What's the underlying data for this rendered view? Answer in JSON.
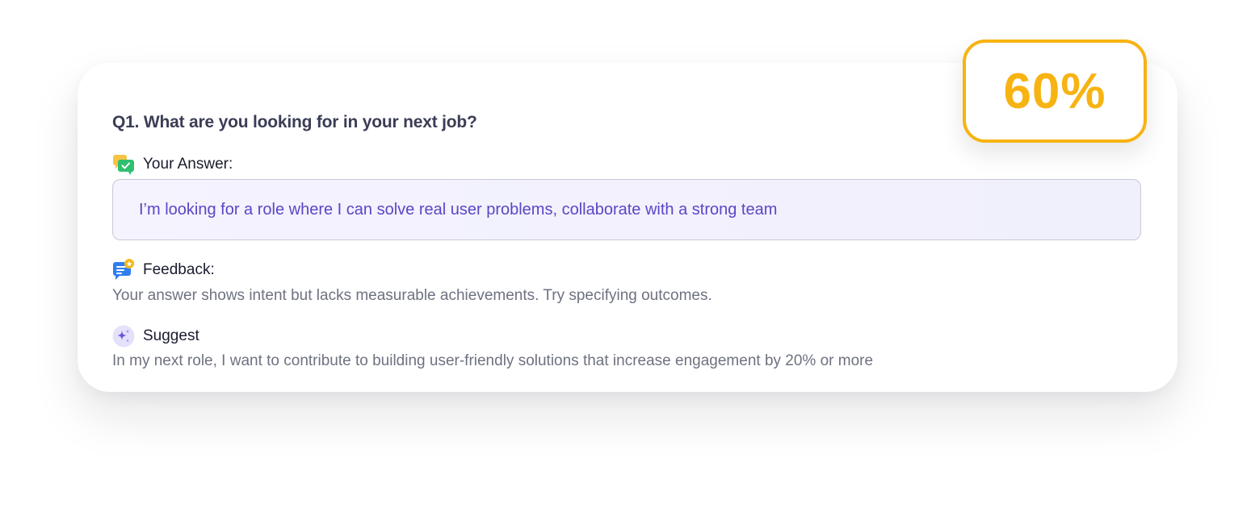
{
  "question": {
    "text": "Q1. What are you looking for in your next job?"
  },
  "answer": {
    "label": "Your Answer:",
    "icon": "chat-check-icon",
    "text": "I’m looking for a role where I can solve real user problems, collaborate with a strong team"
  },
  "feedback": {
    "label": "Feedback:",
    "icon": "feedback-star-icon",
    "text": "Your answer shows intent but lacks measurable achievements. Try specifying outcomes."
  },
  "suggest": {
    "label": "Suggest",
    "icon": "sparkle-icon",
    "text": "In my next role, I want to contribute to building user-friendly solutions that increase engagement by 20% or more"
  },
  "score": {
    "value": "60%"
  },
  "colors": {
    "accent_purple": "#5a46c6",
    "score_orange": "#f7b312",
    "answer_bg": "#f3f2fd",
    "body_text": "#6e7280"
  }
}
